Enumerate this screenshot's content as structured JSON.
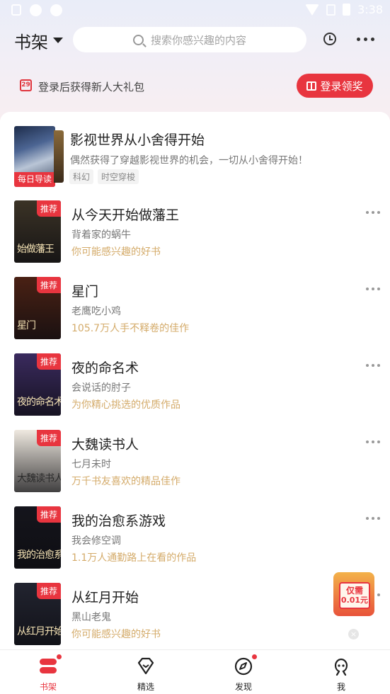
{
  "status_bar": {
    "time": "3:38"
  },
  "header": {
    "title": "书架",
    "search_placeholder": "搜索你感兴趣的内容"
  },
  "promo": {
    "calendar_day": "29",
    "text": "登录后获得新人大礼包",
    "button_label": "登录领奖"
  },
  "featured": {
    "tag": "每日导读",
    "title": "影视世界从小舍得开始",
    "description": "偶然获得了穿越影视世界的机会，一切从小舍得开始！",
    "chips": [
      "科幻",
      "时空穿梭"
    ]
  },
  "books": [
    {
      "badge": "推荐",
      "cover_text": "始做藩王",
      "title": "从今天开始做藩王",
      "author": "背着家的蜗牛",
      "hint": "你可能感兴趣的好书",
      "cover_color": "#3b3326"
    },
    {
      "badge": "推荐",
      "cover_text": "星门",
      "title": "星门",
      "author": "老鹰吃小鸡",
      "hint": "105.7万人手不释卷的佳作",
      "cover_color": "#4a2114"
    },
    {
      "badge": "推荐",
      "cover_text": "夜的命名术",
      "title": "夜的命名术",
      "author": "会说话的肘子",
      "hint": "为你精心挑选的优质作品",
      "cover_color": "#3a2a5e"
    },
    {
      "badge": "推荐",
      "cover_text": "大魏读书人",
      "title": "大魏读书人",
      "author": "七月未时",
      "hint": "万千书友喜欢的精品佳作",
      "cover_color": "#efe9e0"
    },
    {
      "badge": "推荐",
      "cover_text": "我的治愈系游戏",
      "title": "我的治愈系游戏",
      "author": "我会修空调",
      "hint": "1.1万人通勤路上在看的作品",
      "cover_color": "#15151c"
    },
    {
      "badge": "推荐",
      "cover_text": "从红月开始",
      "title": "从红月开始",
      "author": "黑山老鬼",
      "hint": "你可能感兴趣的好书",
      "cover_color": "#222430"
    }
  ],
  "float_gift": {
    "line1": "仅需",
    "line2": "0.01元"
  },
  "tabs": [
    {
      "label": "书架",
      "active": true
    },
    {
      "label": "精选"
    },
    {
      "label": "发现"
    },
    {
      "label": "我"
    }
  ],
  "colors": {
    "accent": "#e8353f",
    "hint": "#d4ab6a"
  }
}
